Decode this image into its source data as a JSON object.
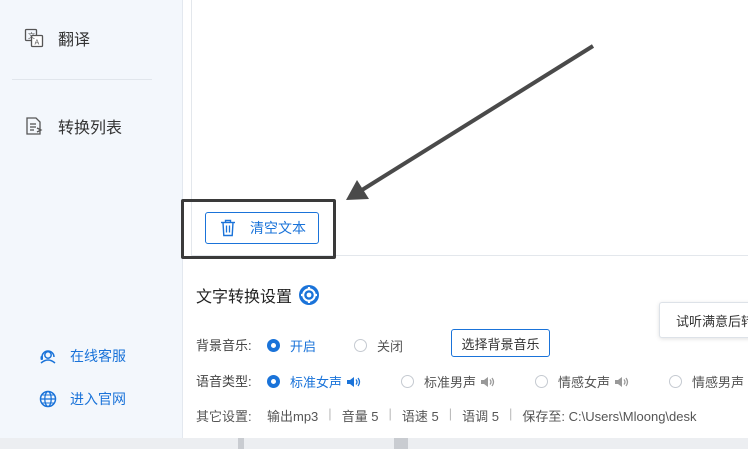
{
  "sidebar": {
    "items": [
      {
        "label": "翻译",
        "icon": "translate-icon"
      },
      {
        "label": "转换列表",
        "icon": "list-convert-icon"
      }
    ],
    "links": [
      {
        "label": "在线客服",
        "icon": "headset-icon"
      },
      {
        "label": "进入官网",
        "icon": "globe-icon"
      }
    ]
  },
  "editor": {
    "clear_label": "清空文本"
  },
  "settings": {
    "title": "文字转换设置",
    "tooltip": "试听满意后转",
    "bgm": {
      "label": "背景音乐:",
      "options": [
        {
          "label": "开启",
          "selected": true
        },
        {
          "label": "关闭",
          "selected": false
        }
      ],
      "button": "选择背景音乐"
    },
    "voice": {
      "label": "语音类型:",
      "options": [
        {
          "label": "标准女声",
          "selected": true
        },
        {
          "label": "标准男声",
          "selected": false
        },
        {
          "label": "情感女声",
          "selected": false
        },
        {
          "label": "情感男声",
          "selected": false
        }
      ]
    },
    "other": {
      "label": "其它设置:",
      "format": "输出mp3",
      "volume": "音量 5",
      "speed": "语速 5",
      "pitch": "语调 5",
      "save": "保存至: C:\\Users\\Mloong\\desk"
    }
  },
  "colors": {
    "accent": "#1a73d9",
    "sidebar_bg": "#f3f7fc",
    "highlight_border": "#3a3a3a"
  }
}
